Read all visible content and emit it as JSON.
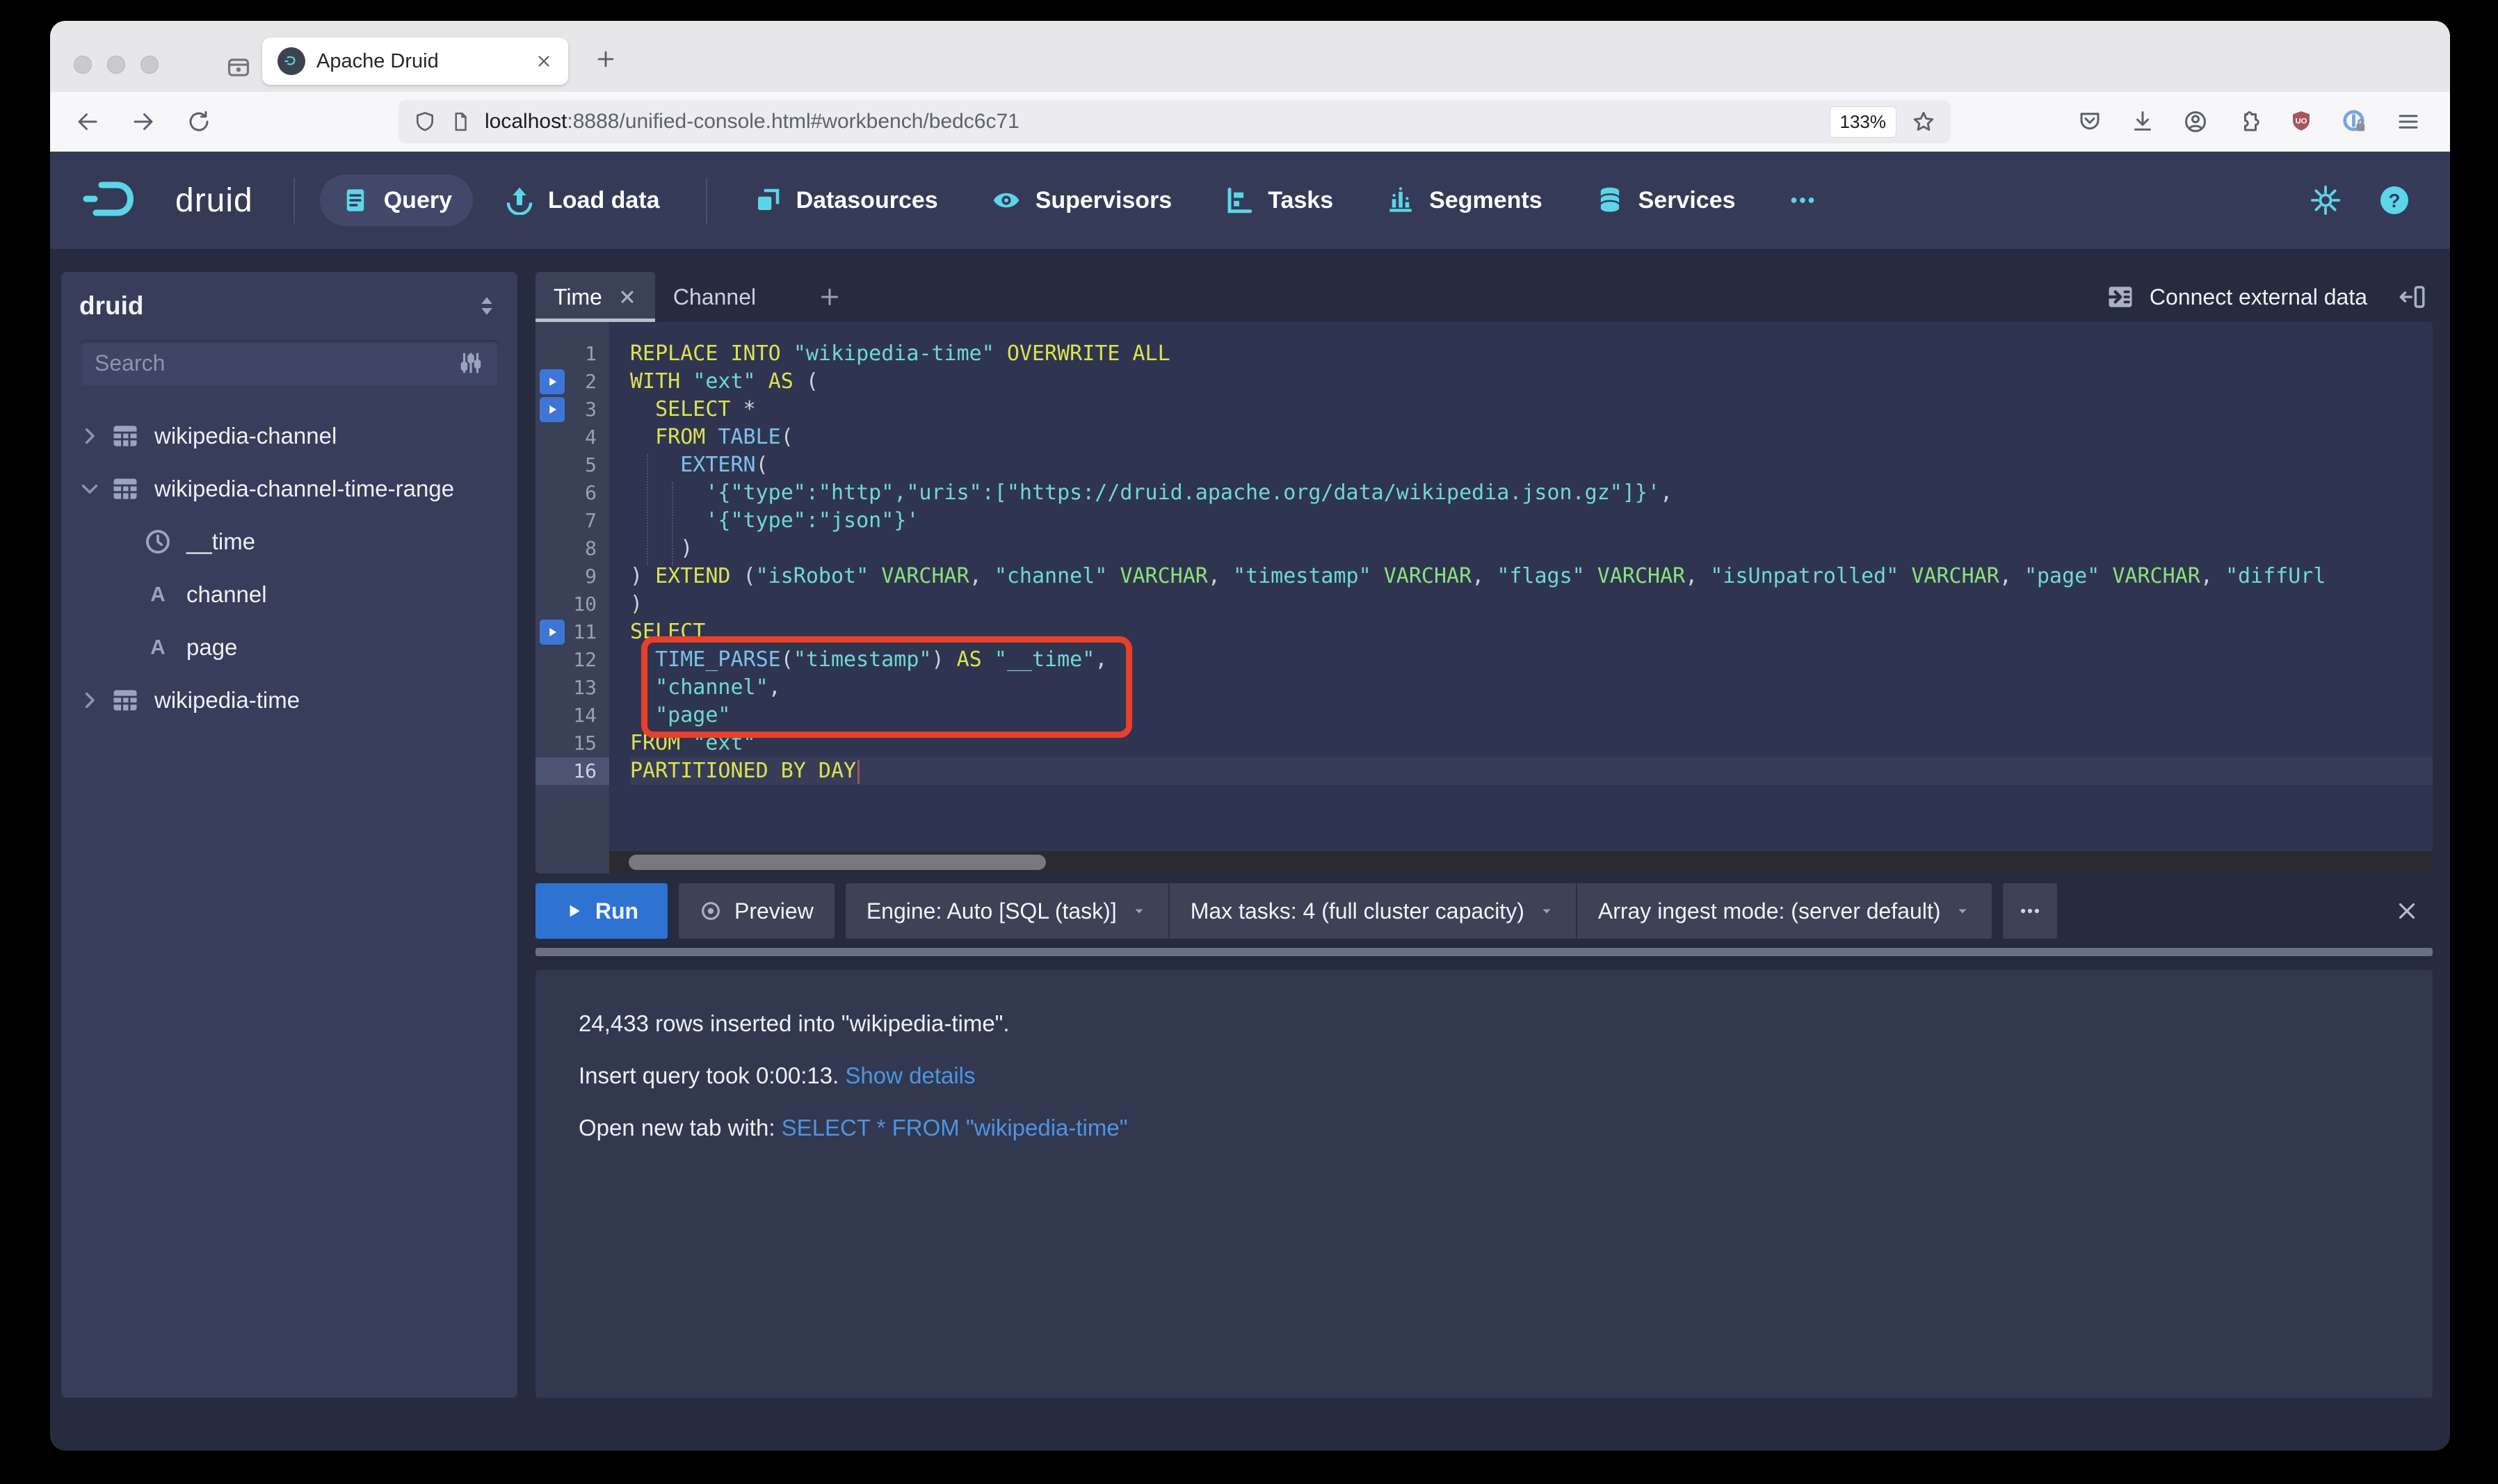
{
  "browser": {
    "tab_title": "Apache Druid",
    "url_host": "localhost",
    "url_rest": ":8888/unified-console.html#workbench/bedc6c71",
    "zoom_badge": "133%"
  },
  "navbar": {
    "brand": "druid",
    "items": [
      {
        "label": "Query",
        "icon": "query-icon",
        "active": true
      },
      {
        "label": "Load data",
        "icon": "load-data-icon"
      },
      {
        "divider": true
      },
      {
        "label": "Datasources",
        "icon": "datasources-icon"
      },
      {
        "label": "Supervisors",
        "icon": "supervisors-icon"
      },
      {
        "label": "Tasks",
        "icon": "tasks-icon"
      },
      {
        "label": "Segments",
        "icon": "segments-icon"
      },
      {
        "label": "Services",
        "icon": "services-icon"
      },
      {
        "label": "",
        "icon": "more-icon"
      }
    ]
  },
  "sidebar": {
    "title": "druid",
    "search_placeholder": "Search",
    "tree": [
      {
        "label": "wikipedia-channel",
        "icon": "table-icon",
        "chevron": "chevron-right-icon",
        "level": 0
      },
      {
        "label": "wikipedia-channel-time-range",
        "icon": "table-icon",
        "chevron": "chevron-down-icon",
        "level": 0
      },
      {
        "label": "__time",
        "icon": "clock-icon",
        "level": 1
      },
      {
        "label": "channel",
        "icon": "letter-a-icon",
        "level": 1
      },
      {
        "label": "page",
        "icon": "letter-a-icon",
        "level": 1
      },
      {
        "label": "wikipedia-time",
        "icon": "table-icon",
        "chevron": "chevron-right-icon",
        "level": 0
      }
    ]
  },
  "workbench": {
    "tabs": [
      {
        "label": "Time",
        "active": true,
        "closable": true
      },
      {
        "label": "Channel",
        "active": false,
        "closable": false
      }
    ],
    "connect_label": "Connect external data",
    "editor": {
      "run_buttons": [
        2,
        3,
        11
      ],
      "active_line": 16,
      "annotation": {
        "from_line": 12,
        "to_line": 14
      },
      "lines": [
        {
          "indent": 0,
          "tokens": [
            [
              "kw",
              "REPLACE INTO"
            ],
            [
              "pln",
              " "
            ],
            [
              "str",
              "\"wikipedia-time\""
            ],
            [
              "pln",
              " "
            ],
            [
              "kw",
              "OVERWRITE ALL"
            ]
          ]
        },
        {
          "indent": 0,
          "tokens": [
            [
              "kw",
              "WITH"
            ],
            [
              "pln",
              " "
            ],
            [
              "str",
              "\"ext\""
            ],
            [
              "pln",
              " "
            ],
            [
              "kw",
              "AS"
            ],
            [
              "pln",
              " "
            ],
            [
              "pun",
              "("
            ]
          ]
        },
        {
          "indent": 2,
          "tokens": [
            [
              "kw",
              "SELECT"
            ],
            [
              "pln",
              " "
            ],
            [
              "pun",
              "*"
            ]
          ]
        },
        {
          "indent": 2,
          "tokens": [
            [
              "kw",
              "FROM"
            ],
            [
              "pln",
              " "
            ],
            [
              "fn",
              "TABLE"
            ],
            [
              "pun",
              "("
            ]
          ]
        },
        {
          "indent": 4,
          "tokens": [
            [
              "fn",
              "EXTERN"
            ],
            [
              "pun",
              "("
            ]
          ]
        },
        {
          "indent": 6,
          "tokens": [
            [
              "str",
              "'{\"type\":\"http\",\"uris\":[\"https://druid.apache.org/data/wikipedia.json.gz\"]}'"
            ],
            [
              "pun",
              ","
            ]
          ]
        },
        {
          "indent": 6,
          "tokens": [
            [
              "str",
              "'{\"type\":\"json\"}'"
            ]
          ]
        },
        {
          "indent": 4,
          "tokens": [
            [
              "pun",
              ")"
            ]
          ]
        },
        {
          "indent": 0,
          "tokens": [
            [
              "pun",
              ") "
            ],
            [
              "kw",
              "EXTEND"
            ],
            [
              "pun",
              " ("
            ],
            [
              "str",
              "\"isRobot\""
            ],
            [
              "typ",
              " VARCHAR"
            ],
            [
              "pun",
              ", "
            ],
            [
              "str",
              "\"channel\""
            ],
            [
              "typ",
              " VARCHAR"
            ],
            [
              "pun",
              ", "
            ],
            [
              "str",
              "\"timestamp\""
            ],
            [
              "typ",
              " VARCHAR"
            ],
            [
              "pun",
              ", "
            ],
            [
              "str",
              "\"flags\""
            ],
            [
              "typ",
              " VARCHAR"
            ],
            [
              "pun",
              ", "
            ],
            [
              "str",
              "\"isUnpatrolled\""
            ],
            [
              "typ",
              " VARCHAR"
            ],
            [
              "pun",
              ", "
            ],
            [
              "str",
              "\"page\""
            ],
            [
              "typ",
              " VARCHAR"
            ],
            [
              "pun",
              ", "
            ],
            [
              "str",
              "\"diffUrl"
            ]
          ]
        },
        {
          "indent": 0,
          "tokens": [
            [
              "pun",
              ")"
            ]
          ]
        },
        {
          "indent": 0,
          "tokens": [
            [
              "kw",
              "SELECT"
            ]
          ]
        },
        {
          "indent": 2,
          "tokens": [
            [
              "fn",
              "TIME_PARSE"
            ],
            [
              "pun",
              "("
            ],
            [
              "str",
              "\"timestamp\""
            ],
            [
              "pun",
              ")"
            ],
            [
              "pln",
              " "
            ],
            [
              "kw",
              "AS"
            ],
            [
              "pln",
              " "
            ],
            [
              "str",
              "\"__time\""
            ],
            [
              "pun",
              ","
            ]
          ]
        },
        {
          "indent": 2,
          "tokens": [
            [
              "str",
              "\"channel\""
            ],
            [
              "pun",
              ","
            ]
          ]
        },
        {
          "indent": 2,
          "tokens": [
            [
              "str",
              "\"page\""
            ]
          ]
        },
        {
          "indent": 0,
          "tokens": [
            [
              "kw",
              "FROM"
            ],
            [
              "pln",
              " "
            ],
            [
              "str",
              "\"ext\""
            ]
          ]
        },
        {
          "indent": 0,
          "tokens": [
            [
              "kw",
              "PARTITIONED BY DAY"
            ]
          ]
        }
      ]
    },
    "runbar": {
      "run_label": "Run",
      "preview_label": "Preview",
      "selects": [
        "Engine: Auto [SQL (task)]",
        "Max tasks: 4 (full cluster capacity)",
        "Array ingest mode: (server default)"
      ]
    },
    "results": [
      [
        {
          "text": "24,433 rows inserted into \"wikipedia-time\"."
        }
      ],
      [
        {
          "text": "Insert query took 0:00:13. "
        },
        {
          "text": "Show details",
          "link": true
        }
      ],
      [
        {
          "text": "Open new tab with: "
        },
        {
          "text": "SELECT * FROM \"wikipedia-time\"",
          "link": true
        }
      ]
    ]
  },
  "colors": {
    "accent_cyan": "#5bd6e8",
    "run_blue": "#2e72d2",
    "link_blue": "#4e95e2",
    "annotation_red": "#e8402a",
    "syntax_keyword": "#dde24f",
    "syntax_string": "#70d9cd",
    "syntax_function": "#7bc1eb",
    "syntax_type": "#8ce07c"
  }
}
